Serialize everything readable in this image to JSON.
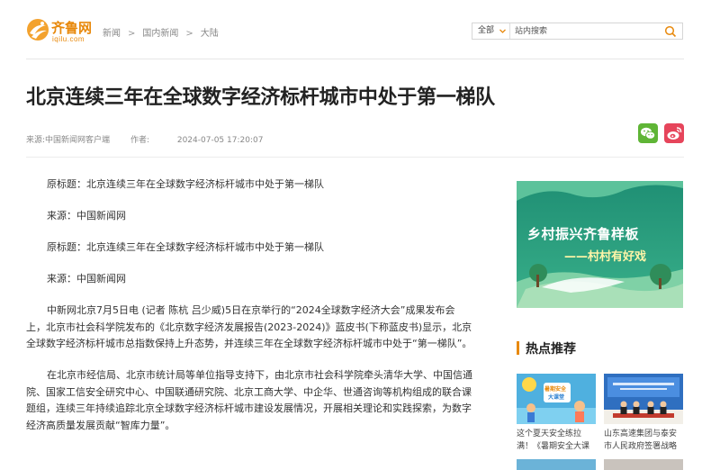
{
  "site": {
    "logo_cn": "齐鲁网",
    "logo_en": "iqilu.com"
  },
  "breadcrumb": [
    "新闻",
    "国内新闻",
    "大陆"
  ],
  "breadcrumb_sep": ">",
  "search": {
    "scope": "全部",
    "placeholder": "站内搜索"
  },
  "article": {
    "title": "北京连续三年在全球数字经济标杆城市中处于第一梯队",
    "source_label": "来源:",
    "source": "中国新闻网客户端",
    "author_label": "作者:",
    "author": "",
    "time": "2024-07-05 17:20:07",
    "paragraphs": [
      "原标题：北京连续三年在全球数字经济标杆城市中处于第一梯队",
      "来源：中国新闻网",
      "原标题：北京连续三年在全球数字经济标杆城市中处于第一梯队",
      "来源：中国新闻网",
      "中新网北京7月5日电 (记者 陈杭 吕少威)5日在京举行的“2024全球数字经济大会”成果发布会上，北京市社会科学院发布的《北京数字经济发展报告(2023-2024)》蓝皮书(下称蓝皮书)显示，北京全球数字经济标杆城市总指数保持上升态势，并连续三年在全球数字经济标杆城市中处于“第一梯队”。",
      "在北京市经信局、北京市统计局等单位指导支持下，由北京市社会科学院牵头清华大学、中国信通院、国家工信安全研究中心、中国联通研究院、北京工商大学、中企华、世通咨询等机构组成的联合课题组，连续三年持续追踪北京全球数字经济标杆城市建设发展情况，开展相关理论和实践探索，为数字经济高质量发展贡献“智库力量”。"
    ]
  },
  "sidebar": {
    "banner": {
      "line1": "乡村振兴齐鲁样板",
      "line2": "——村村有好戏"
    },
    "hot_title": "热点推荐",
    "hot_items": [
      {
        "caption": "这个夏天安全练拉满！《暑期安全大课堂》五",
        "img_label_top": "暑期安全",
        "img_label_bottom": "大课堂"
      },
      {
        "caption": "山东高速集团与泰安市人民政府签署战略合作",
        "img_label_top": "",
        "img_label_bottom": ""
      }
    ]
  },
  "colors": {
    "brand": "#e8890c",
    "wechat": "#5fb536",
    "weibo": "#e6455b",
    "banner_bg": "#2e9e7c"
  },
  "icons": [
    "logo-swirl-icon",
    "chevron-down-icon",
    "search-icon",
    "wechat-icon",
    "weibo-icon"
  ]
}
